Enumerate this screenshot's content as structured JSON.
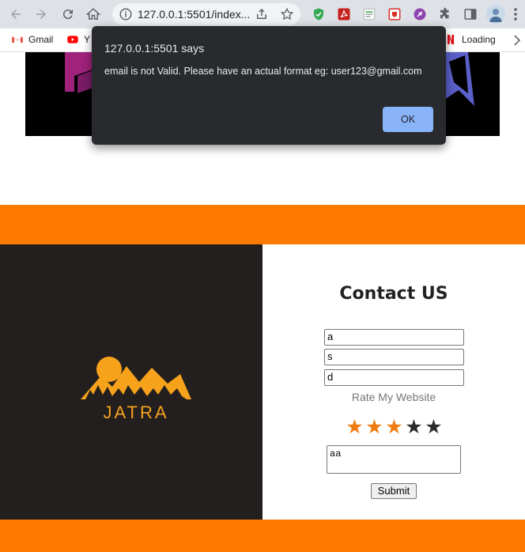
{
  "browser": {
    "url": "127.0.0.1:5501/index...",
    "bookmarks": [
      {
        "label": "Gmail"
      },
      {
        "label": "Y"
      },
      {
        "label": "Loading"
      }
    ]
  },
  "dialog": {
    "title": "127.0.0.1:5501 says",
    "message": "email is not Valid. Please have an actual format eg: user123@gmail.com",
    "ok_label": "OK"
  },
  "logo": {
    "text": "JATRA"
  },
  "contact": {
    "title": "Contact US",
    "fields": [
      {
        "value": "a"
      },
      {
        "value": "s"
      },
      {
        "value": "d"
      }
    ],
    "rate_label": "Rate My Website",
    "rating": 3,
    "rating_max": 5,
    "comment": "aa",
    "submit_label": "Submit"
  },
  "colors": {
    "accent": "#ff7b00",
    "dark_panel": "#231f1f",
    "star_on": "#f07b10",
    "dialog_bg": "#292a2d",
    "dialog_button": "#8ab4f8"
  }
}
